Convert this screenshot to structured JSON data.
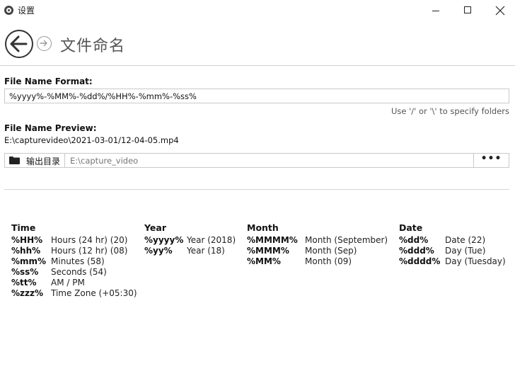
{
  "window": {
    "title": "设置"
  },
  "header": {
    "title": "文件命名"
  },
  "format": {
    "label": "File Name Format:",
    "value": "%yyyy%-%MM%-%dd%/%HH%-%mm%-%ss%",
    "hint": "Use '/' or '\\' to specify folders"
  },
  "preview": {
    "label": "File Name Preview:",
    "value": "E:\\capturevideo\\2021-03-01/12-04-05.mp4"
  },
  "output": {
    "button_label": "输出目录",
    "path_placeholder": "E:\\capture_video",
    "more_label": "•••"
  },
  "legend": {
    "time": {
      "heading": "Time",
      "rows": [
        {
          "code": "%HH%",
          "desc": "Hours (24 hr) (20)"
        },
        {
          "code": "%hh%",
          "desc": "Hours (12 hr) (08)"
        },
        {
          "code": "%mm%",
          "desc": "Minutes (58)"
        },
        {
          "code": "%ss%",
          "desc": "Seconds (54)"
        },
        {
          "code": "%tt%",
          "desc": "AM / PM"
        },
        {
          "code": "%zzz%",
          "desc": "Time Zone (+05:30)"
        }
      ]
    },
    "year": {
      "heading": "Year",
      "rows": [
        {
          "code": "%yyyy%",
          "desc": "Year (2018)"
        },
        {
          "code": "%yy%",
          "desc": "Year (18)"
        }
      ]
    },
    "month": {
      "heading": "Month",
      "rows": [
        {
          "code": "%MMMM%",
          "desc": "Month (September)"
        },
        {
          "code": "%MMM%",
          "desc": "Month (Sep)"
        },
        {
          "code": "%MM%",
          "desc": "Month (09)"
        }
      ]
    },
    "date": {
      "heading": "Date",
      "rows": [
        {
          "code": "%dd%",
          "desc": "Date (22)"
        },
        {
          "code": "%ddd%",
          "desc": "Day (Tue)"
        },
        {
          "code": "%dddd%",
          "desc": "Day (Tuesday)"
        }
      ]
    }
  }
}
